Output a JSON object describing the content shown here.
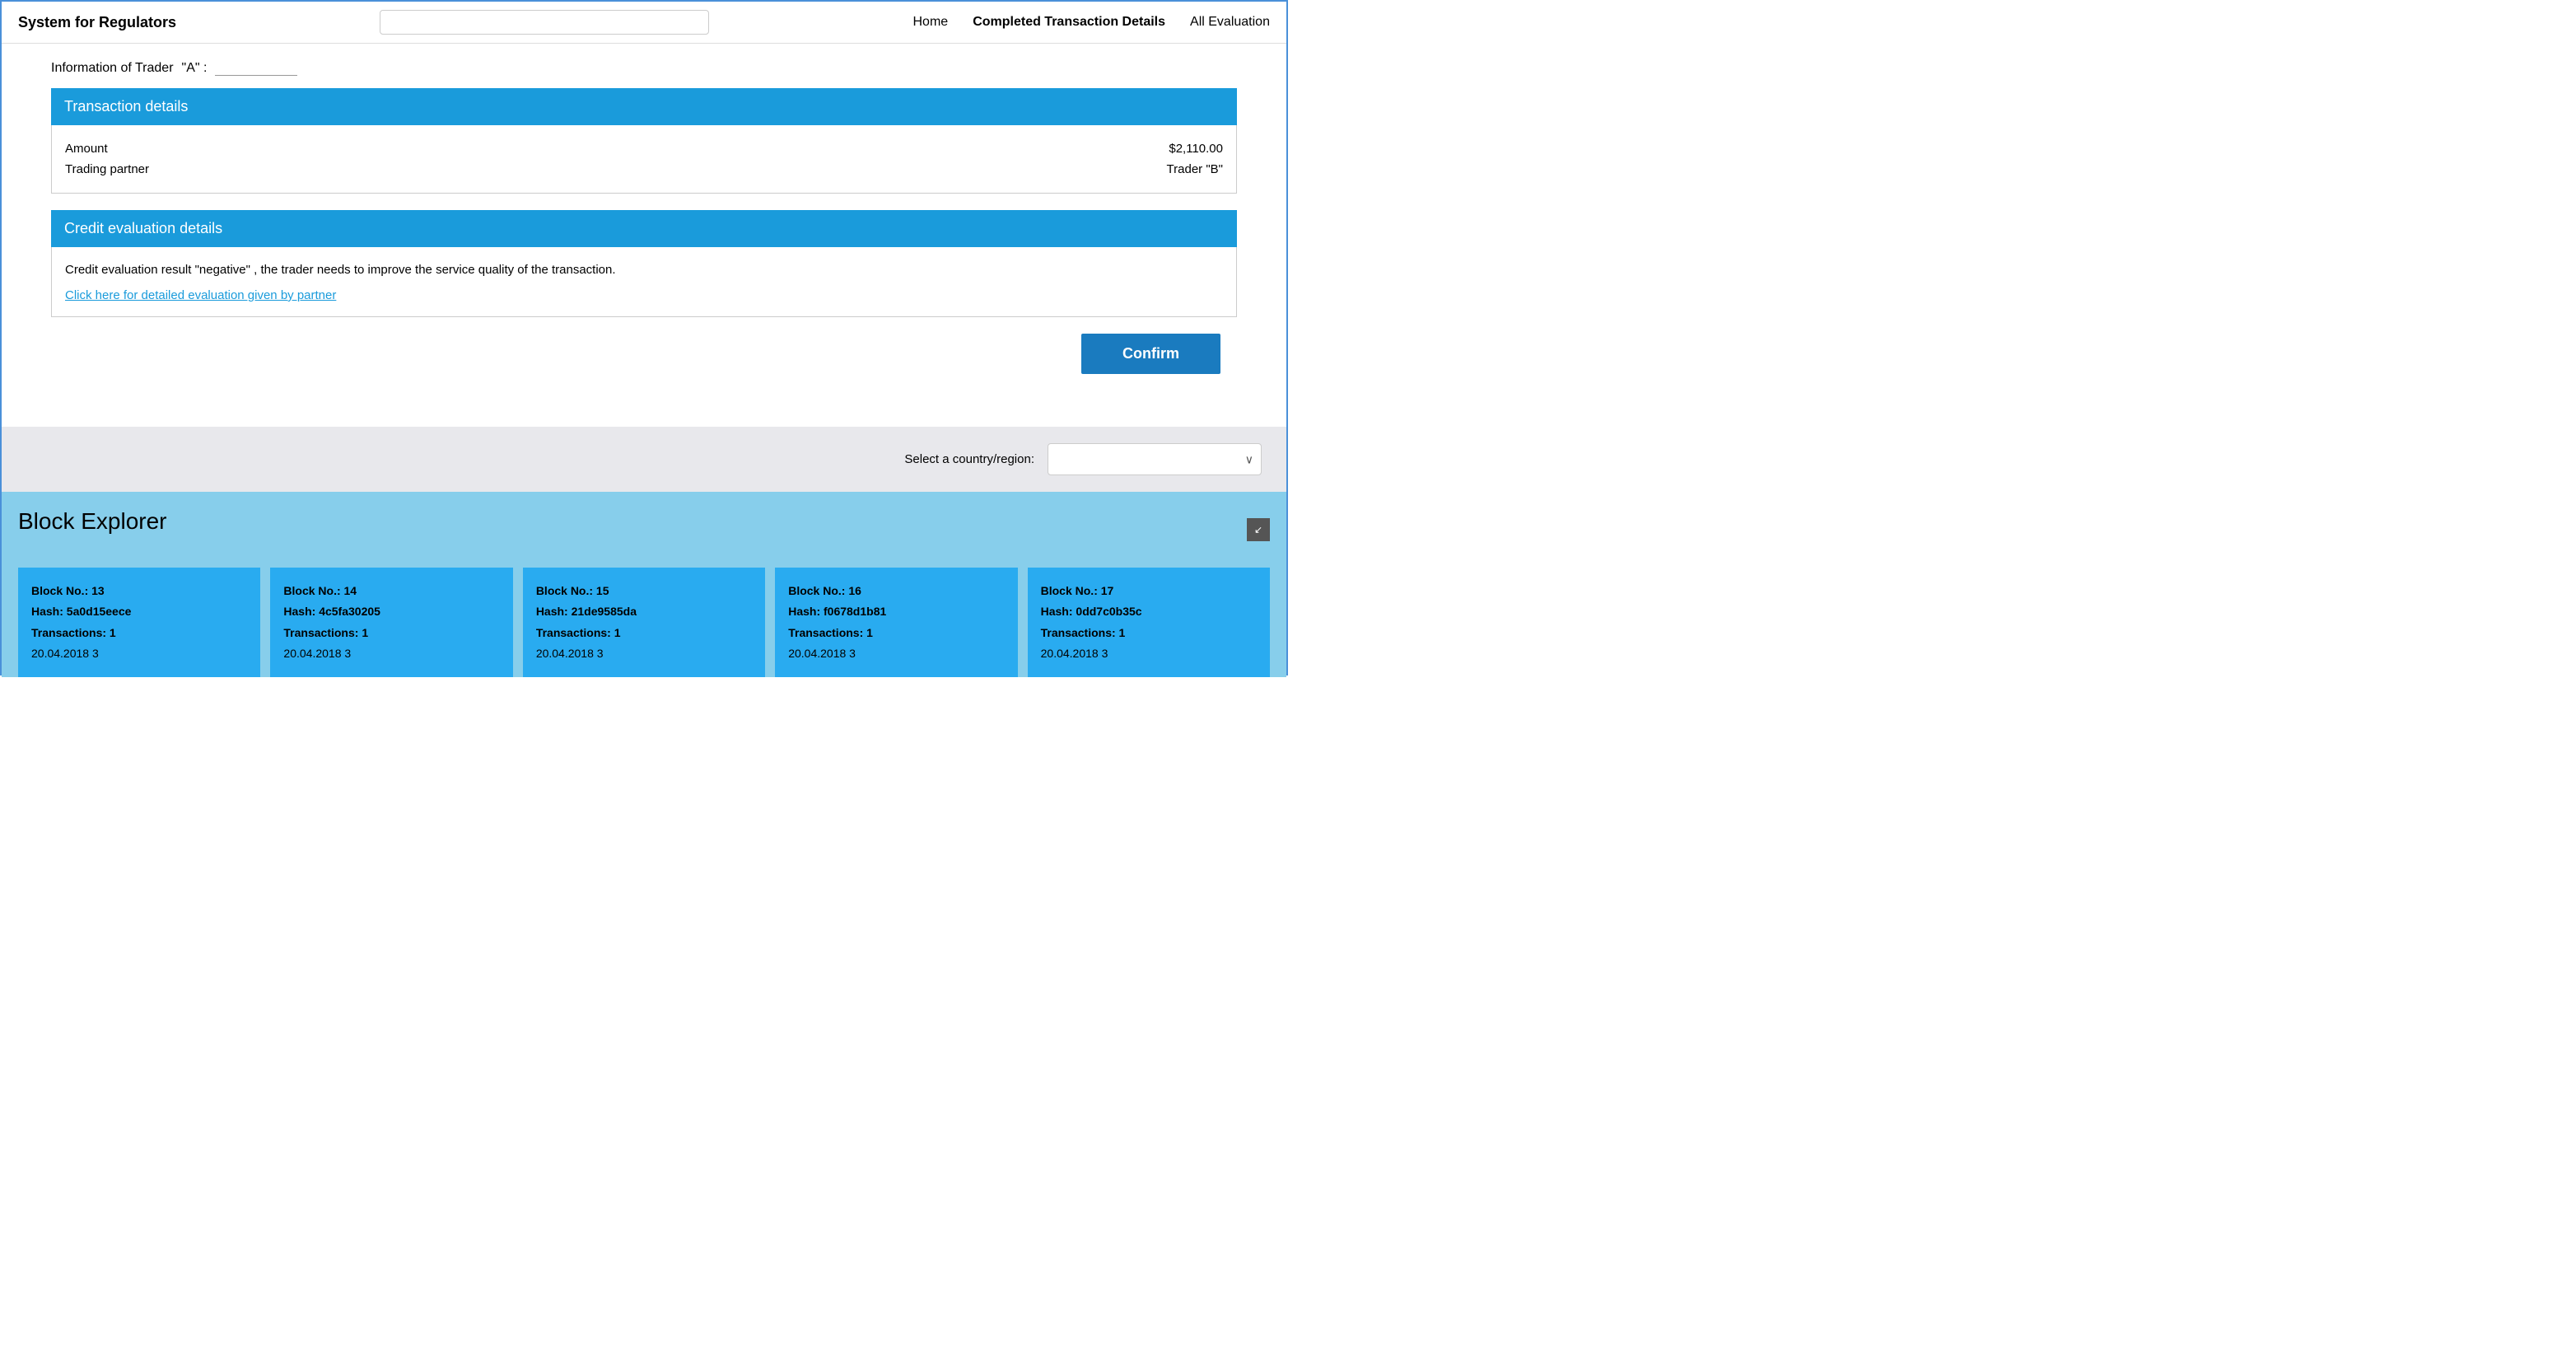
{
  "navbar": {
    "brand": "System for Regulators",
    "search_placeholder": "",
    "links": [
      {
        "label": "Home",
        "key": "home"
      },
      {
        "label": "Completed Transaction Details",
        "key": "completed"
      },
      {
        "label": "All Evaluation",
        "key": "evaluation"
      }
    ]
  },
  "trader_section": {
    "label": "Information of Trader",
    "trader_name": "\"A\" :",
    "trader_input_placeholder": ""
  },
  "transaction_details": {
    "header": "Transaction details",
    "rows": [
      {
        "label": "Amount",
        "value": "$2,110.00"
      },
      {
        "label": "Trading  partner",
        "value": "Trader  \"B\""
      }
    ]
  },
  "credit_evaluation": {
    "header": "Credit evaluation details",
    "result_text": "Credit evaluation result              \"negative\" , the trader needs to improve the service quality of the transaction.",
    "link_text": "Click here for detailed evaluation given by partner",
    "confirm_label": "Confirm"
  },
  "country_section": {
    "label": "Select a country/region:"
  },
  "block_explorer": {
    "title": "Block Explorer",
    "minimize_icon": "↙",
    "blocks": [
      {
        "block_no": "Block No.: 13",
        "hash": "Hash: 5a0d15eece",
        "transactions": "Transactions: 1",
        "date": "20.04.2018 3"
      },
      {
        "block_no": "Block No.: 14",
        "hash": "Hash: 4c5fa30205",
        "transactions": "Transactions: 1",
        "date": "20.04.2018 3"
      },
      {
        "block_no": "Block No.: 15",
        "hash": "Hash: 21de9585da",
        "transactions": "Transactions: 1",
        "date": "20.04.2018 3"
      },
      {
        "block_no": "Block No.: 16",
        "hash": "Hash: f0678d1b81",
        "transactions": "Transactions: 1",
        "date": "20.04.2018 3"
      },
      {
        "block_no": "Block No.: 17",
        "hash": "Hash: 0dd7c0b35c",
        "transactions": "Transactions: 1",
        "date": "20.04.2018 3"
      }
    ]
  }
}
